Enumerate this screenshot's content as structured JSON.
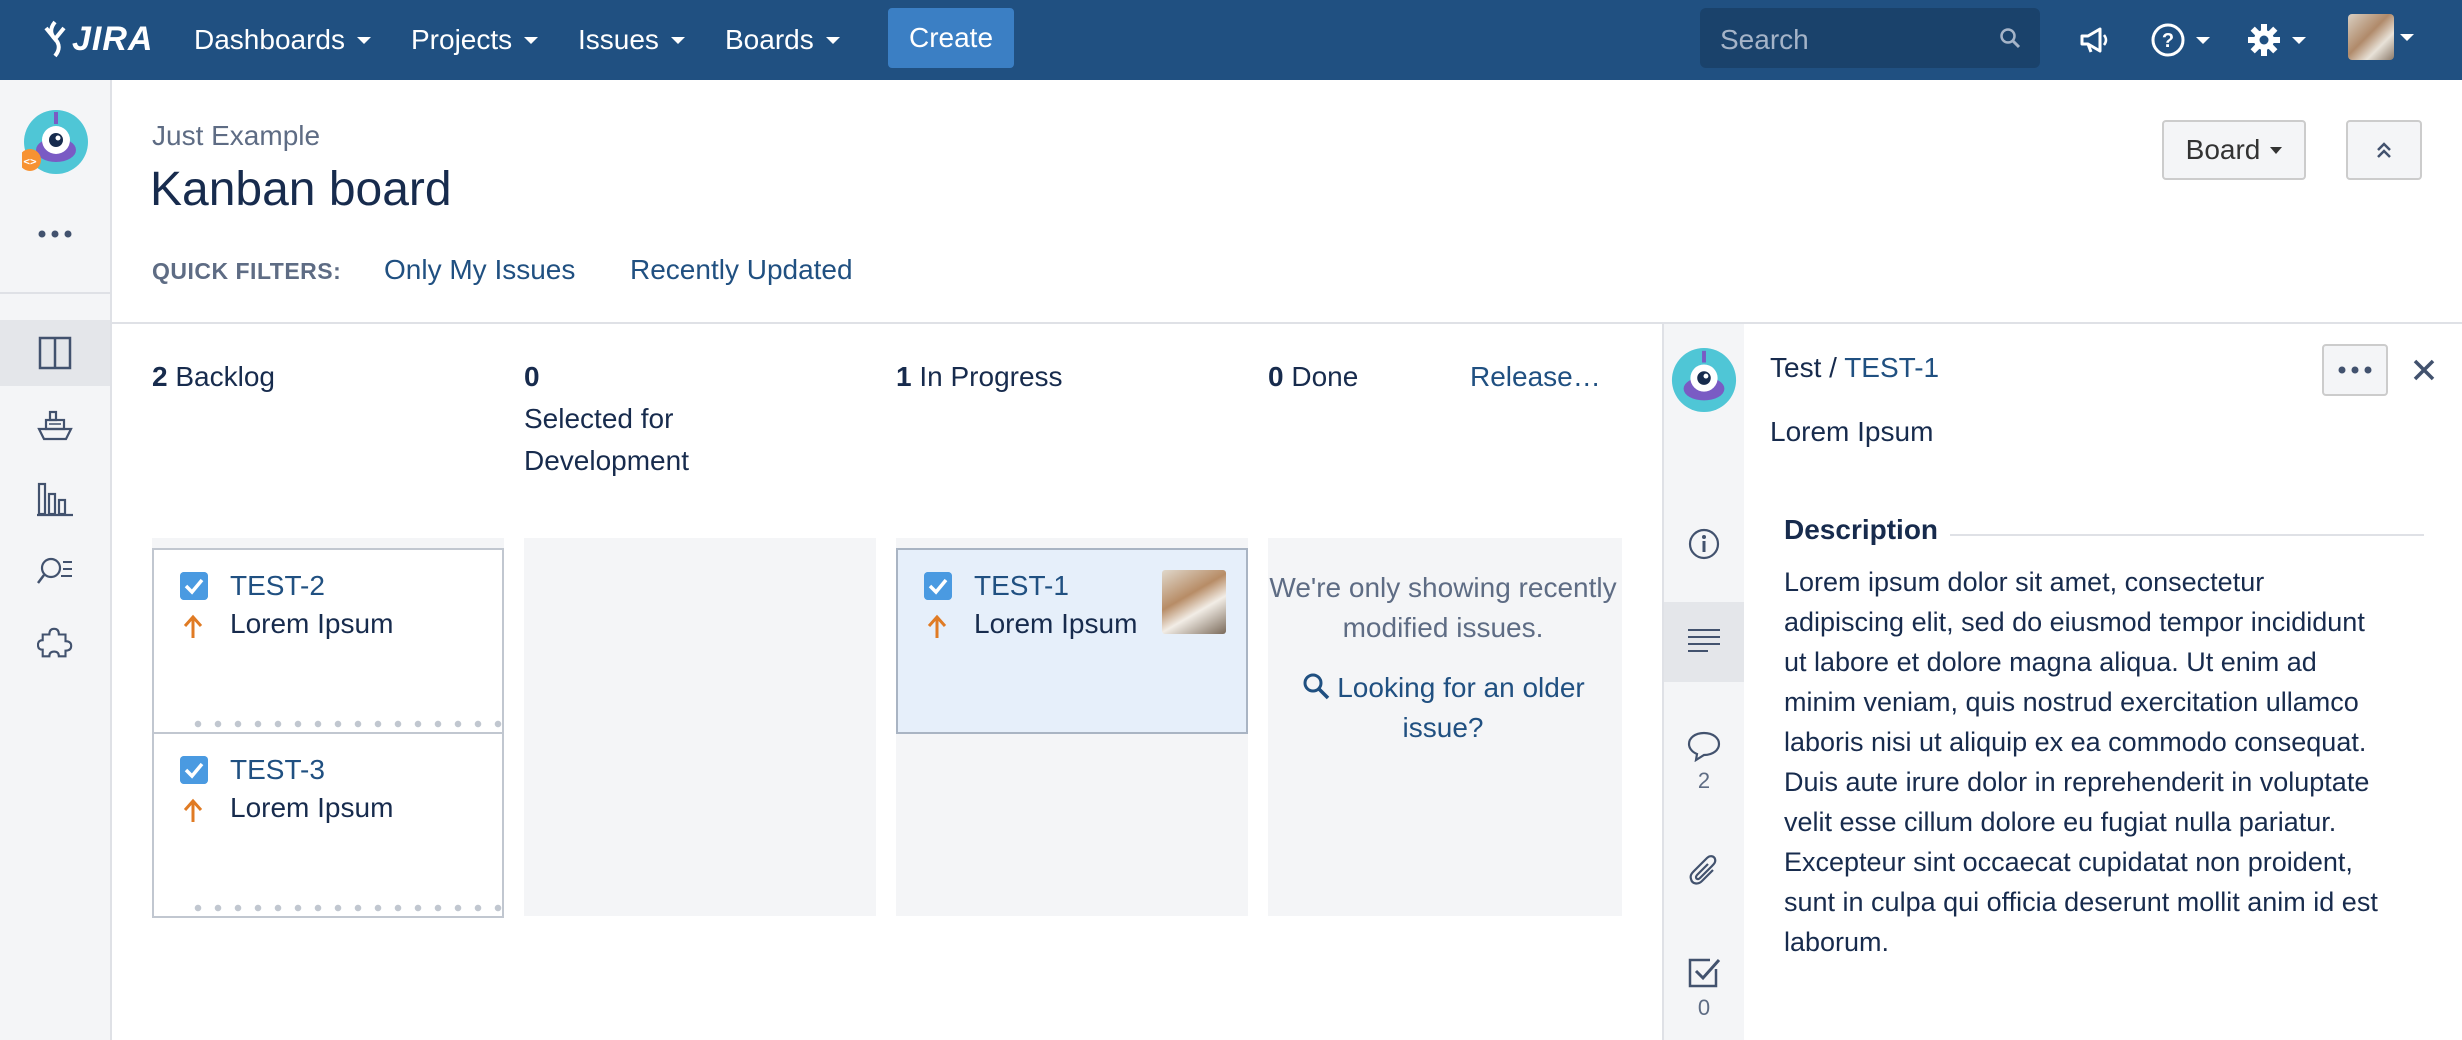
{
  "app": {
    "logo_text": "JIRA",
    "nav": [
      "Dashboards",
      "Projects",
      "Issues",
      "Boards"
    ],
    "create_label": "Create",
    "search_placeholder": "Search"
  },
  "header": {
    "breadcrumb": "Just Example",
    "title": "Kanban board",
    "quick_filters_label": "QUICK FILTERS:",
    "quick_filters": [
      "Only My Issues",
      "Recently Updated"
    ],
    "board_button": "Board"
  },
  "sidebar": {
    "more": "•••",
    "items": [
      "board-icon",
      "releases-ship-icon",
      "reports-chart-icon",
      "issues-search-icon",
      "add-ons-puzzle-icon"
    ]
  },
  "columns": [
    {
      "count": "2",
      "name": "Backlog"
    },
    {
      "count": "0",
      "name": "Selected for Development"
    },
    {
      "count": "1",
      "name": "In Progress"
    },
    {
      "count": "0",
      "name": "Done"
    }
  ],
  "release_link": "Release…",
  "cards": [
    {
      "key": "TEST-2",
      "summary": "Lorem Ipsum"
    },
    {
      "key": "TEST-3",
      "summary": "Lorem Ipsum"
    },
    {
      "key": "TEST-1",
      "summary": "Lorem Ipsum"
    }
  ],
  "done_column": {
    "message": "We're only showing recently modified issues.",
    "older_link": "Looking for an older issue?"
  },
  "detail": {
    "project": "Test",
    "separator": " / ",
    "issue_key": "TEST-1",
    "summary": "Lorem Ipsum",
    "description_heading": "Description",
    "description": "Lorem ipsum dolor sit amet, consectetur adipiscing elit, sed do eiusmod tempor incididunt ut labore et dolore magna aliqua. Ut enim ad minim veniam, quis nostrud exercitation ullamco laboris nisi ut aliquip ex ea commodo consequat. Duis aute irure dolor in reprehenderit in voluptate velit esse cillum dolore eu fugiat nulla pariatur. Excepteur sint occaecat cupidatat non proident, sunt in culpa qui officia deserunt mollit anim id est laborum.",
    "comments_count": "2",
    "checklist_count": "0"
  },
  "colors": {
    "nav_bg": "#205081",
    "create_bg": "#3b7fc4",
    "link": "#205081",
    "priority_arrow": "#e07b24",
    "checkbox": "#4a9ae1"
  }
}
